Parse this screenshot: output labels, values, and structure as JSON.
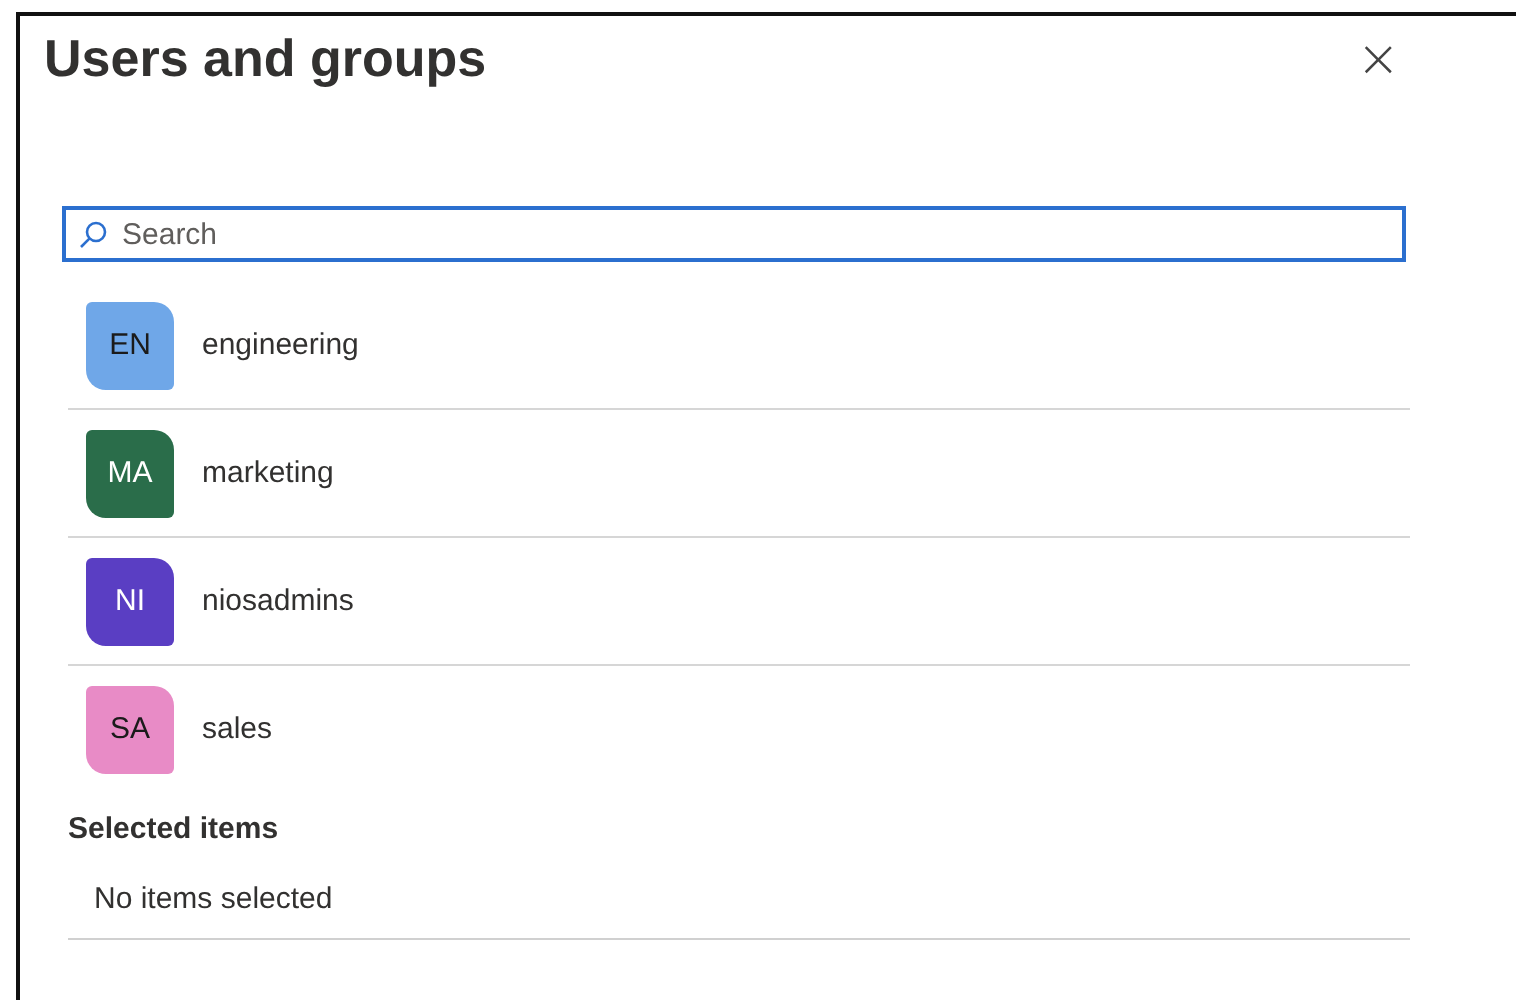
{
  "panel": {
    "title": "Users and groups",
    "close": "×"
  },
  "search": {
    "placeholder": "Search"
  },
  "groups": [
    {
      "initials": "EN",
      "name": "engineering",
      "color": "#6fa7e8"
    },
    {
      "initials": "MA",
      "name": "marketing",
      "color": "#2a6d4a"
    },
    {
      "initials": "NI",
      "name": "niosadmins",
      "color": "#5a3ec3"
    },
    {
      "initials": "SA",
      "name": "sales",
      "color": "#e88bc6"
    }
  ],
  "selected_items": {
    "heading": "Selected items",
    "empty_text": "No items selected"
  }
}
